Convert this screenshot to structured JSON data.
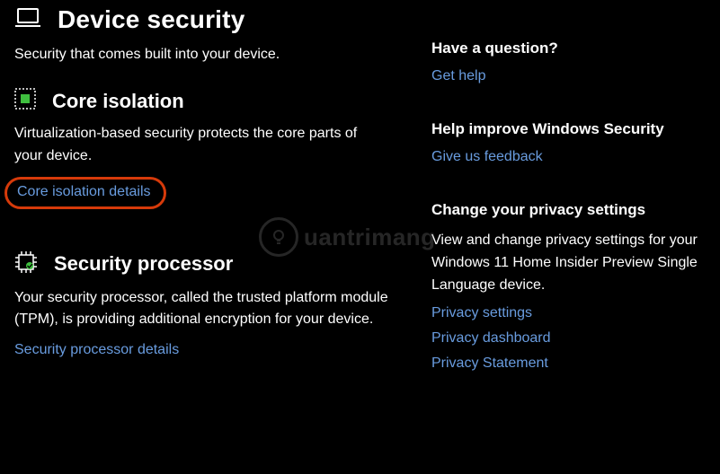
{
  "header": {
    "title": "Device security",
    "subtitle": "Security that comes built into your device."
  },
  "core_isolation": {
    "title": "Core isolation",
    "desc": "Virtualization-based security protects the core parts of your device.",
    "link": "Core isolation details"
  },
  "security_processor": {
    "title": "Security processor",
    "desc": "Your security processor, called the trusted platform module (TPM), is providing additional encryption for your device.",
    "link": "Security processor details"
  },
  "aside": {
    "question": {
      "heading": "Have a question?",
      "link": "Get help"
    },
    "improve": {
      "heading": "Help improve Windows Security",
      "link": "Give us feedback"
    },
    "privacy": {
      "heading": "Change your privacy settings",
      "desc": "View and change privacy settings for your Windows 11 Home Insider Preview Single Language device.",
      "links": {
        "settings": "Privacy settings",
        "dashboard": "Privacy dashboard",
        "statement": "Privacy Statement"
      }
    }
  },
  "watermark": "uantrimang"
}
